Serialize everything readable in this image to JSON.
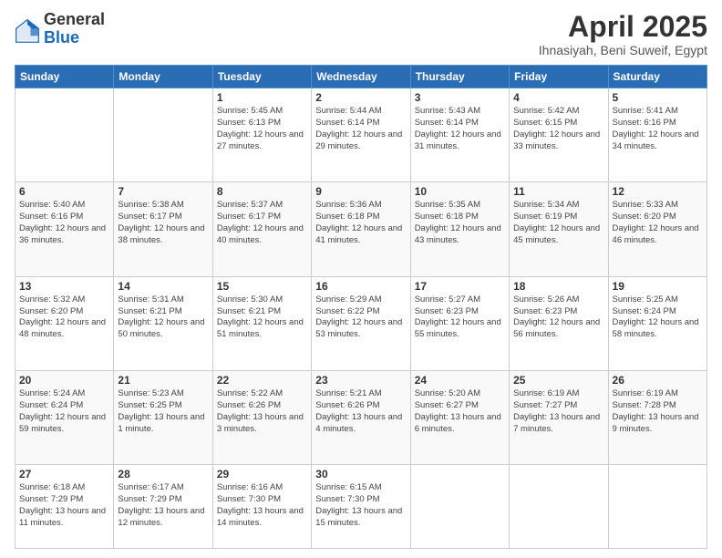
{
  "header": {
    "logo_general": "General",
    "logo_blue": "Blue",
    "title": "April 2025",
    "location": "Ihnasiyah, Beni Suweif, Egypt"
  },
  "days_of_week": [
    "Sunday",
    "Monday",
    "Tuesday",
    "Wednesday",
    "Thursday",
    "Friday",
    "Saturday"
  ],
  "weeks": [
    [
      {
        "day": "",
        "info": ""
      },
      {
        "day": "",
        "info": ""
      },
      {
        "day": "1",
        "info": "Sunrise: 5:45 AM\nSunset: 6:13 PM\nDaylight: 12 hours and 27 minutes."
      },
      {
        "day": "2",
        "info": "Sunrise: 5:44 AM\nSunset: 6:14 PM\nDaylight: 12 hours and 29 minutes."
      },
      {
        "day": "3",
        "info": "Sunrise: 5:43 AM\nSunset: 6:14 PM\nDaylight: 12 hours and 31 minutes."
      },
      {
        "day": "4",
        "info": "Sunrise: 5:42 AM\nSunset: 6:15 PM\nDaylight: 12 hours and 33 minutes."
      },
      {
        "day": "5",
        "info": "Sunrise: 5:41 AM\nSunset: 6:16 PM\nDaylight: 12 hours and 34 minutes."
      }
    ],
    [
      {
        "day": "6",
        "info": "Sunrise: 5:40 AM\nSunset: 6:16 PM\nDaylight: 12 hours and 36 minutes."
      },
      {
        "day": "7",
        "info": "Sunrise: 5:38 AM\nSunset: 6:17 PM\nDaylight: 12 hours and 38 minutes."
      },
      {
        "day": "8",
        "info": "Sunrise: 5:37 AM\nSunset: 6:17 PM\nDaylight: 12 hours and 40 minutes."
      },
      {
        "day": "9",
        "info": "Sunrise: 5:36 AM\nSunset: 6:18 PM\nDaylight: 12 hours and 41 minutes."
      },
      {
        "day": "10",
        "info": "Sunrise: 5:35 AM\nSunset: 6:18 PM\nDaylight: 12 hours and 43 minutes."
      },
      {
        "day": "11",
        "info": "Sunrise: 5:34 AM\nSunset: 6:19 PM\nDaylight: 12 hours and 45 minutes."
      },
      {
        "day": "12",
        "info": "Sunrise: 5:33 AM\nSunset: 6:20 PM\nDaylight: 12 hours and 46 minutes."
      }
    ],
    [
      {
        "day": "13",
        "info": "Sunrise: 5:32 AM\nSunset: 6:20 PM\nDaylight: 12 hours and 48 minutes."
      },
      {
        "day": "14",
        "info": "Sunrise: 5:31 AM\nSunset: 6:21 PM\nDaylight: 12 hours and 50 minutes."
      },
      {
        "day": "15",
        "info": "Sunrise: 5:30 AM\nSunset: 6:21 PM\nDaylight: 12 hours and 51 minutes."
      },
      {
        "day": "16",
        "info": "Sunrise: 5:29 AM\nSunset: 6:22 PM\nDaylight: 12 hours and 53 minutes."
      },
      {
        "day": "17",
        "info": "Sunrise: 5:27 AM\nSunset: 6:23 PM\nDaylight: 12 hours and 55 minutes."
      },
      {
        "day": "18",
        "info": "Sunrise: 5:26 AM\nSunset: 6:23 PM\nDaylight: 12 hours and 56 minutes."
      },
      {
        "day": "19",
        "info": "Sunrise: 5:25 AM\nSunset: 6:24 PM\nDaylight: 12 hours and 58 minutes."
      }
    ],
    [
      {
        "day": "20",
        "info": "Sunrise: 5:24 AM\nSunset: 6:24 PM\nDaylight: 12 hours and 59 minutes."
      },
      {
        "day": "21",
        "info": "Sunrise: 5:23 AM\nSunset: 6:25 PM\nDaylight: 13 hours and 1 minute."
      },
      {
        "day": "22",
        "info": "Sunrise: 5:22 AM\nSunset: 6:26 PM\nDaylight: 13 hours and 3 minutes."
      },
      {
        "day": "23",
        "info": "Sunrise: 5:21 AM\nSunset: 6:26 PM\nDaylight: 13 hours and 4 minutes."
      },
      {
        "day": "24",
        "info": "Sunrise: 5:20 AM\nSunset: 6:27 PM\nDaylight: 13 hours and 6 minutes."
      },
      {
        "day": "25",
        "info": "Sunrise: 6:19 AM\nSunset: 7:27 PM\nDaylight: 13 hours and 7 minutes."
      },
      {
        "day": "26",
        "info": "Sunrise: 6:19 AM\nSunset: 7:28 PM\nDaylight: 13 hours and 9 minutes."
      }
    ],
    [
      {
        "day": "27",
        "info": "Sunrise: 6:18 AM\nSunset: 7:29 PM\nDaylight: 13 hours and 11 minutes."
      },
      {
        "day": "28",
        "info": "Sunrise: 6:17 AM\nSunset: 7:29 PM\nDaylight: 13 hours and 12 minutes."
      },
      {
        "day": "29",
        "info": "Sunrise: 6:16 AM\nSunset: 7:30 PM\nDaylight: 13 hours and 14 minutes."
      },
      {
        "day": "30",
        "info": "Sunrise: 6:15 AM\nSunset: 7:30 PM\nDaylight: 13 hours and 15 minutes."
      },
      {
        "day": "",
        "info": ""
      },
      {
        "day": "",
        "info": ""
      },
      {
        "day": "",
        "info": ""
      }
    ]
  ]
}
